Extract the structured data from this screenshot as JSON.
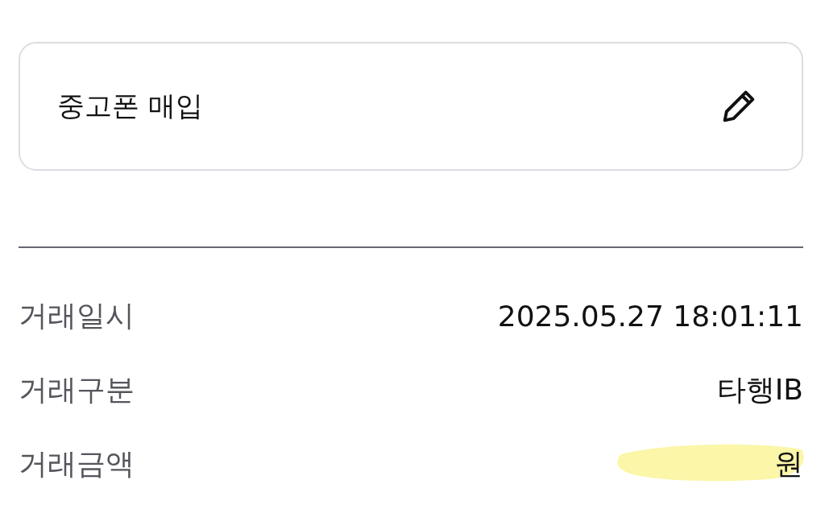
{
  "memo": {
    "text": "중고폰 매입"
  },
  "details": [
    {
      "label": "거래일시",
      "value": "2025.05.27 18:01:11",
      "redacted": false
    },
    {
      "label": "거래구분",
      "value": "타행IB",
      "redacted": false
    },
    {
      "label": "거래금액",
      "value": "원",
      "redacted": true
    }
  ]
}
